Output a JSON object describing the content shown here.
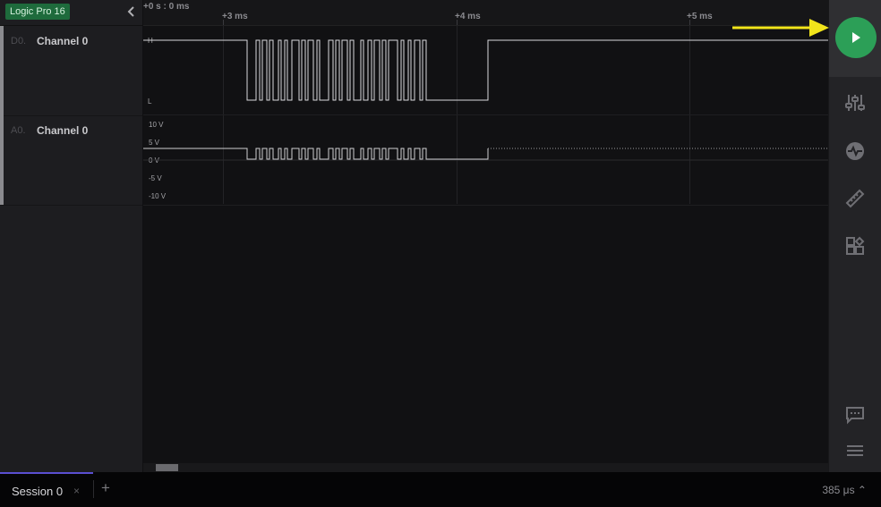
{
  "device": {
    "badge": "Logic Pro 16"
  },
  "channels": [
    {
      "id": "D0.",
      "name": "Channel 0"
    },
    {
      "id": "A0.",
      "name": "Channel 0"
    }
  ],
  "ruler": {
    "origin": "+0 s : 0 ms",
    "labels": [
      "+3 ms",
      "+4 ms",
      "+5 ms"
    ]
  },
  "digital_axis": {
    "high": "H",
    "low": "L"
  },
  "analog_axis": [
    "10 V",
    "5 V",
    "0 V",
    "-5 V",
    "-10 V"
  ],
  "toolbar": {
    "icons": [
      "play-icon",
      "sliders-icon",
      "analyzer-icon",
      "ruler-icon",
      "extensions-icon",
      "chat-icon",
      "menu-icon"
    ]
  },
  "session": {
    "label": "Session 0",
    "close": "×",
    "add": "+"
  },
  "status": {
    "sample_rate": "385 μs ⌃"
  },
  "colors": {
    "accent": "#2c9f57",
    "badge": "#1e6b3c",
    "arrow": "#f2e51b",
    "tab_underline": "#5a4fd1"
  }
}
